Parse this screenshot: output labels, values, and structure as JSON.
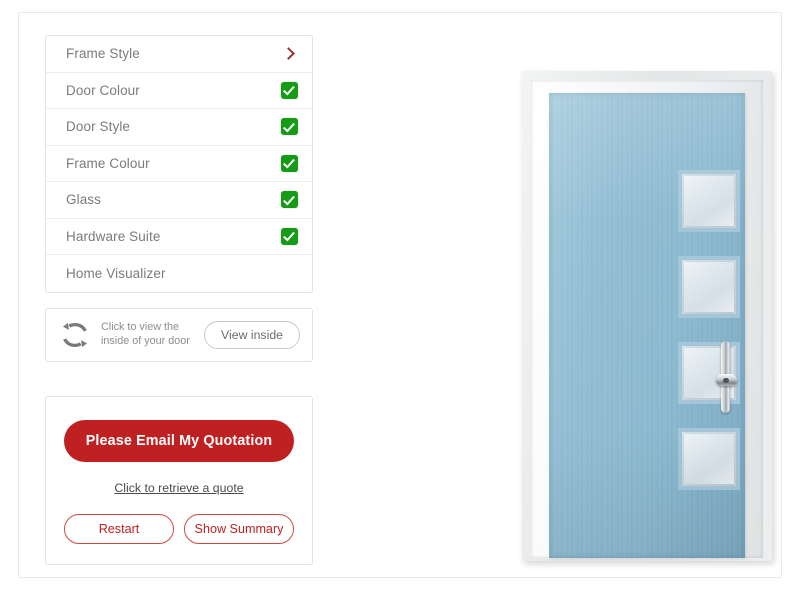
{
  "options_menu": {
    "items": [
      {
        "label": "Frame Style",
        "state": "chevron"
      },
      {
        "label": "Door Colour",
        "state": "checked"
      },
      {
        "label": "Door Style",
        "state": "checked"
      },
      {
        "label": "Frame Colour",
        "state": "checked"
      },
      {
        "label": "Glass",
        "state": "checked"
      },
      {
        "label": "Hardware Suite",
        "state": "checked"
      },
      {
        "label": "Home Visualizer",
        "state": "none"
      }
    ]
  },
  "view_inside": {
    "icon": "rotate-icon",
    "caption_line1": "Click to view the",
    "caption_line2": "inside of your door",
    "button_label": "View inside"
  },
  "quote_panel": {
    "email_quote_label": "Please Email My Quotation",
    "retrieve_link_label": "Click to retrieve a quote",
    "restart_label": "Restart",
    "summary_label": "Show Summary"
  },
  "door_preview": {
    "door_colour": "#8bb9d0",
    "frame_colour": "#f0f1f2",
    "glass_colour": "#dfe8ee",
    "handle_colour": "#cfd4d8",
    "glass_panel_count": 4
  },
  "colors": {
    "accent_red": "#bf2021",
    "tick_green": "#159b16",
    "chevron_red": "#9d2f2f",
    "text_grey": "#7b7b7b",
    "border_grey": "#e2e2e2"
  }
}
